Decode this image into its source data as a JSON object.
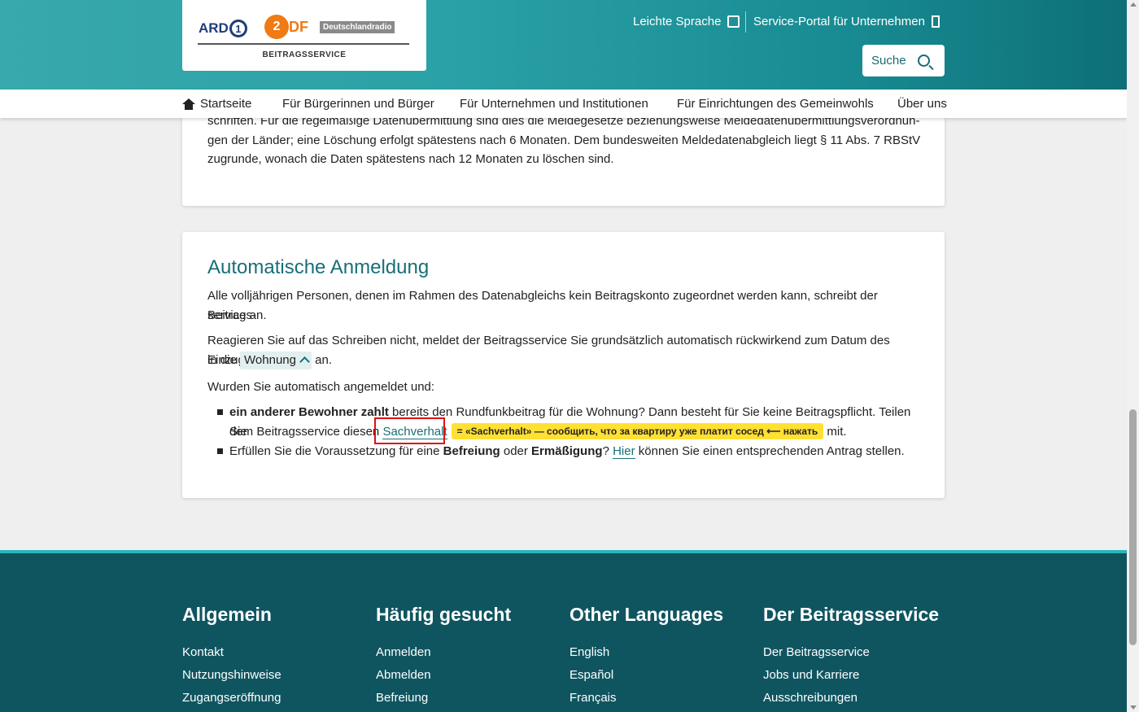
{
  "header": {
    "logo": {
      "ard": "ARD",
      "ard_mark": "1",
      "zdf": "DF",
      "zdf_mark": "2",
      "dlr": "Deutschlandradio",
      "subtitle": "BEITRAGSSERVICE"
    },
    "links": [
      {
        "label": "Leichte Sprache",
        "icon": "book-icon"
      },
      {
        "label": "Service-Portal für Unternehmen",
        "icon": "door-icon"
      }
    ],
    "search_label": "Suche"
  },
  "nav": {
    "items": [
      {
        "label": "Startseite",
        "icon": "home-icon"
      },
      {
        "label": "Für Bürgerinnen und Bürger"
      },
      {
        "label": "Für Unternehmen und Institutionen"
      },
      {
        "label": "Für Einrichtungen des Gemeinwohls"
      },
      {
        "label": "Über uns"
      }
    ]
  },
  "card1": {
    "line1": "schriften. Für die regelmäßige Datenübermittlung sind dies die Meldegesetze beziehungsweise Meldedatenübermittlungsverordnun-",
    "line2": "gen der Länder; eine Löschung erfolgt spätestens nach 6 Monaten. Dem bundesweiten Meldedatenabgleich liegt § 11 Abs. 7 RBStV",
    "line3": "zugrunde, wonach die Daten spätestens nach 12 Monaten zu löschen sind."
  },
  "card2": {
    "heading": "Automatische Anmeldung",
    "p1_line1": "Alle volljährigen Personen, denen im Rahmen des Datenabgleichs kein Beitragskonto zugeordnet werden kann, schreibt der Beitrags-",
    "p1_line2": "service an.",
    "p2_line1": "Reagieren Sie auf das Schreiben nicht, meldet der Beitragsservice Sie grundsätzlich automatisch rückwirkend zum Datum des Einzugs",
    "p2_pre": "in die",
    "p2_chip": "Wohnung",
    "p2_post": "an.",
    "p3": "Wurden Sie automatisch angemeldet und:",
    "b1_bold": "ein anderer Bewohner zahlt",
    "b1_rest": " bereits den Rundfunkbeitrag für die Wohnung? Dann besteht für Sie keine Beitragspflicht. Teilen Sie",
    "b1_line2_pre": "dem Beitragsservice diesen ",
    "b1_link": "Sachverhalt",
    "b1_note": "= «Sachverhalt» — сообщить, что за квартиру уже платит сосед ⟵ нажать",
    "b1_post": " mit.",
    "b2_pre": "Erfüllen Sie die Voraussetzung für eine ",
    "b2_bold1": "Befreiung",
    "b2_mid": " oder ",
    "b2_bold2": "Ermäßigung",
    "b2_q": "? ",
    "b2_link": "Hier",
    "b2_post": " können Sie einen entsprechenden Antrag stellen."
  },
  "footer": {
    "columns": [
      {
        "heading": "Allgemein",
        "links": [
          "Kontakt",
          "Nutzungshinweise",
          "Zugangseröffnung"
        ]
      },
      {
        "heading": "Häufig gesucht",
        "links": [
          "Anmelden",
          "Abmelden",
          "Befreiung"
        ]
      },
      {
        "heading": "Other Languages",
        "links": [
          "English",
          "Español",
          "Français"
        ]
      },
      {
        "heading": "Der Beitragsservice",
        "links": [
          "Der Beitragsservice",
          "Jobs und Karriere",
          "Ausschreibungen"
        ]
      }
    ]
  },
  "colors": {
    "brand_teal": "#186f78",
    "footer_bg": "#0f5560",
    "highlight_box": "#dd1111",
    "note_bg": "#ffe033"
  }
}
